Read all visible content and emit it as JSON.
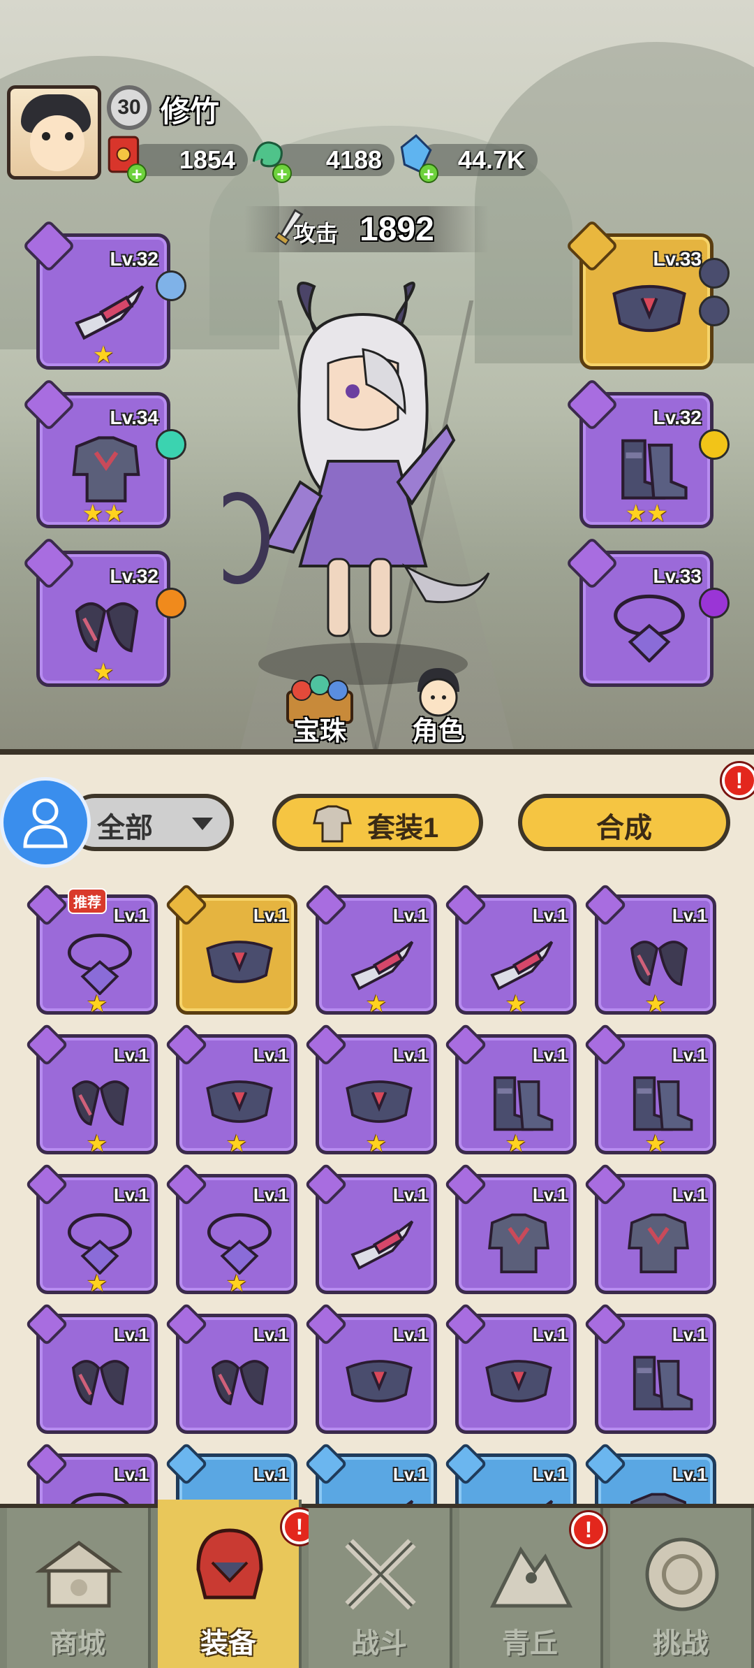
{
  "player": {
    "level": "30",
    "name": "修竹",
    "resources": [
      {
        "icon": "red-envelope-icon",
        "value": "1854"
      },
      {
        "icon": "jade-dragon-icon",
        "value": "4188"
      },
      {
        "icon": "blue-crystal-icon",
        "value": "44.7K"
      }
    ]
  },
  "attack": {
    "label": "攻击",
    "value": "1892"
  },
  "equipped": {
    "left": [
      {
        "slot": "weapon",
        "level": "Lv.32",
        "stars": "★",
        "gem": "#7fb2e8"
      },
      {
        "slot": "armor",
        "level": "Lv.34",
        "stars": "★★",
        "gem": "#3bd3b0"
      },
      {
        "slot": "bracer",
        "level": "Lv.32",
        "stars": "★",
        "gem": "#f08a1c"
      }
    ],
    "right": [
      {
        "slot": "belt",
        "level": "Lv.33",
        "stars": "",
        "gem": "#4a4d6e"
      },
      {
        "slot": "boots",
        "level": "Lv.32",
        "stars": "★★",
        "gem": "#f2c418"
      },
      {
        "slot": "necklace",
        "level": "Lv.33",
        "stars": "",
        "gem": "#9a35d6"
      }
    ]
  },
  "scene_buttons": {
    "orbs": "宝珠",
    "character": "角色"
  },
  "filters": {
    "all": "全部",
    "set": "套装1",
    "merge": "合成",
    "alert": "!"
  },
  "inventory": [
    {
      "level": "Lv.1",
      "star": "★",
      "rarity": "purple",
      "type": "necklace",
      "badge": "推荐"
    },
    {
      "level": "Lv.1",
      "star": "",
      "rarity": "gold",
      "type": "belt"
    },
    {
      "level": "Lv.1",
      "star": "★",
      "rarity": "purple",
      "type": "weapon"
    },
    {
      "level": "Lv.1",
      "star": "★",
      "rarity": "purple",
      "type": "weapon"
    },
    {
      "level": "Lv.1",
      "star": "★",
      "rarity": "purple",
      "type": "bracer"
    },
    {
      "level": "Lv.1",
      "star": "★",
      "rarity": "purple",
      "type": "bracer"
    },
    {
      "level": "Lv.1",
      "star": "★",
      "rarity": "purple",
      "type": "belt"
    },
    {
      "level": "Lv.1",
      "star": "★",
      "rarity": "purple",
      "type": "belt"
    },
    {
      "level": "Lv.1",
      "star": "★",
      "rarity": "purple",
      "type": "boots"
    },
    {
      "level": "Lv.1",
      "star": "★",
      "rarity": "purple",
      "type": "boots"
    },
    {
      "level": "Lv.1",
      "star": "★",
      "rarity": "purple",
      "type": "necklace"
    },
    {
      "level": "Lv.1",
      "star": "★",
      "rarity": "purple",
      "type": "necklace"
    },
    {
      "level": "Lv.1",
      "star": "",
      "rarity": "purple",
      "type": "weapon"
    },
    {
      "level": "Lv.1",
      "star": "",
      "rarity": "purple",
      "type": "armor"
    },
    {
      "level": "Lv.1",
      "star": "",
      "rarity": "purple",
      "type": "armor"
    },
    {
      "level": "Lv.1",
      "star": "",
      "rarity": "purple",
      "type": "bracer"
    },
    {
      "level": "Lv.1",
      "star": "",
      "rarity": "purple",
      "type": "bracer"
    },
    {
      "level": "Lv.1",
      "star": "",
      "rarity": "purple",
      "type": "belt"
    },
    {
      "level": "Lv.1",
      "star": "",
      "rarity": "purple",
      "type": "belt"
    },
    {
      "level": "Lv.1",
      "star": "",
      "rarity": "purple",
      "type": "boots"
    },
    {
      "level": "Lv.1",
      "star": "",
      "rarity": "purple",
      "type": "necklace"
    },
    {
      "level": "Lv.1",
      "star": "",
      "rarity": "blue",
      "type": "weapon"
    },
    {
      "level": "Lv.1",
      "star": "",
      "rarity": "blue",
      "type": "weapon"
    },
    {
      "level": "Lv.1",
      "star": "",
      "rarity": "blue",
      "type": "weapon"
    },
    {
      "level": "Lv.1",
      "star": "",
      "rarity": "blue",
      "type": "armor"
    }
  ],
  "nav": [
    {
      "label": "商城",
      "icon": "shop-icon",
      "active": false,
      "alert": ""
    },
    {
      "label": "装备",
      "icon": "helmet-icon",
      "active": true,
      "alert": "!"
    },
    {
      "label": "战斗",
      "icon": "crossed-swords-icon",
      "active": false,
      "alert": ""
    },
    {
      "label": "青丘",
      "icon": "mountain-icon",
      "active": false,
      "alert": "!"
    },
    {
      "label": "挑战",
      "icon": "challenge-orb-icon",
      "active": false,
      "alert": ""
    }
  ],
  "colors": {
    "purple": "#9b6ad9",
    "gold": "#e5b440",
    "blue": "#5aa7e3",
    "button_yellow": "#f5c542",
    "alert_red": "#e3271d"
  }
}
